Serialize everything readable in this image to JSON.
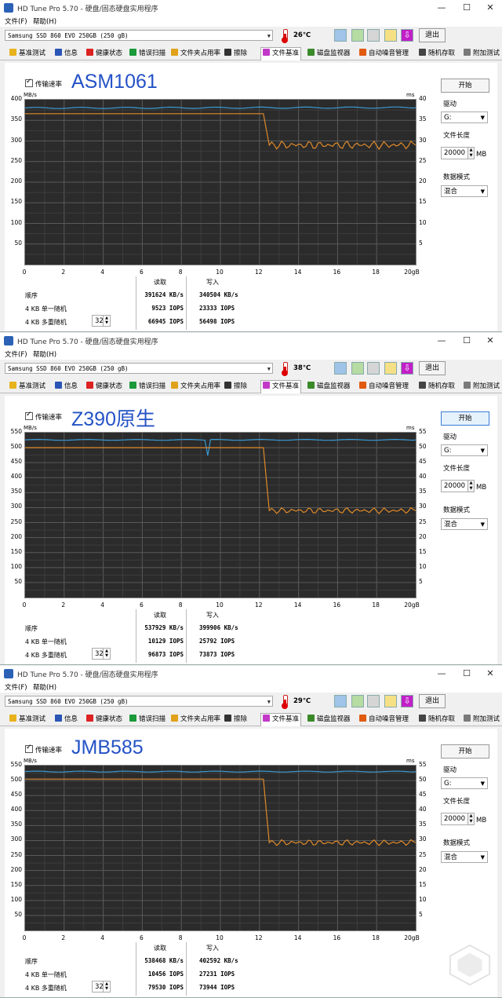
{
  "windows": [
    {
      "title": "HD Tune Pro 5.70 - 硬盘/固态硬盘实用程序",
      "menu": [
        "文件(F)",
        "帮助(H)"
      ],
      "drive": "Samsung SSD 860 EVO 250GB (250 gB)",
      "temperature": "26℃",
      "exit": "退出",
      "tabs": [
        "基准测试",
        "信息",
        "健康状态",
        "错误扫描",
        "文件夹占用率",
        "擦除",
        "文件基准",
        "磁盘监视器",
        "自动噪音管理",
        "随机存取",
        "附加测试"
      ],
      "active_tab": "文件基准",
      "checkbox_label": "传输速率",
      "label": "ASM1061",
      "start": "开始",
      "drive_label": "驱动",
      "drive_letter": "G:",
      "file_length_label": "文件长度",
      "file_length": "20000",
      "file_length_unit": "MB",
      "data_mode_label": "数据模式",
      "data_mode": "混合",
      "units_left": "MB/s",
      "units_right": "ms",
      "col_read": "读取",
      "col_write": "写入",
      "row_seq": "顺序",
      "row_4k": "4 KB 单一随机",
      "row_4k_multi": "4 KB 多重随机",
      "queue_depth": "32",
      "seq_read": "391624 KB/s",
      "seq_write": "340504 KB/s",
      "r4k_read": "9523 IOPS",
      "r4k_write": "23333 IOPS",
      "m4k_read": "66945 IOPS",
      "m4k_write": "56498 IOPS"
    },
    {
      "title": "HD Tune Pro 5.70 - 硬盘/固态硬盘实用程序",
      "menu": [
        "文件(F)",
        "帮助(H)"
      ],
      "drive": "Samsung SSD 860 EVO 250GB (250 gB)",
      "temperature": "38℃",
      "exit": "退出",
      "tabs": [
        "基准测试",
        "信息",
        "健康状态",
        "错误扫描",
        "文件夹占用率",
        "擦除",
        "文件基准",
        "磁盘监视器",
        "自动噪音管理",
        "随机存取",
        "附加测试"
      ],
      "active_tab": "文件基准",
      "checkbox_label": "传输速率",
      "label": "Z390原生",
      "start": "开始",
      "drive_label": "驱动",
      "drive_letter": "G:",
      "file_length_label": "文件长度",
      "file_length": "20000",
      "file_length_unit": "MB",
      "data_mode_label": "数据模式",
      "data_mode": "混合",
      "units_left": "MB/s",
      "units_right": "ms",
      "col_read": "读取",
      "col_write": "写入",
      "row_seq": "顺序",
      "row_4k": "4 KB 单一随机",
      "row_4k_multi": "4 KB 多重随机",
      "queue_depth": "32",
      "seq_read": "537929 KB/s",
      "seq_write": "399906 KB/s",
      "r4k_read": "10129 IOPS",
      "r4k_write": "25792 IOPS",
      "m4k_read": "96873 IOPS",
      "m4k_write": "73873 IOPS"
    },
    {
      "title": "HD Tune Pro 5.70 - 硬盘/固态硬盘实用程序",
      "menu": [
        "文件(F)",
        "帮助(H)"
      ],
      "drive": "Samsung SSD 860 EVO 250GB (250 gB)",
      "temperature": "29℃",
      "exit": "退出",
      "tabs": [
        "基准测试",
        "信息",
        "健康状态",
        "错误扫描",
        "文件夹占用率",
        "擦除",
        "文件基准",
        "磁盘监视器",
        "自动噪音管理",
        "随机存取",
        "附加测试"
      ],
      "active_tab": "文件基准",
      "checkbox_label": "传输速率",
      "label": "JMB585",
      "start": "开始",
      "drive_label": "驱动",
      "drive_letter": "G:",
      "file_length_label": "文件长度",
      "file_length": "20000",
      "file_length_unit": "MB",
      "data_mode_label": "数据模式",
      "data_mode": "混合",
      "units_left": "MB/s",
      "units_right": "ms",
      "col_read": "读取",
      "col_write": "写入",
      "row_seq": "顺序",
      "row_4k": "4 KB 单一随机",
      "row_4k_multi": "4 KB 多重随机",
      "queue_depth": "32",
      "seq_read": "538468 KB/s",
      "seq_write": "402592 KB/s",
      "r4k_read": "10456 IOPS",
      "r4k_write": "27231 IOPS",
      "m4k_read": "79530 IOPS",
      "m4k_write": "73944 IOPS"
    }
  ],
  "chart_data": [
    {
      "type": "line",
      "x_ticks": [
        "0",
        "2",
        "4",
        "6",
        "8",
        "10",
        "12",
        "14",
        "16",
        "18",
        "20gB"
      ],
      "y_ticks_left": [
        "400",
        "350",
        "300",
        "250",
        "200",
        "150",
        "100",
        "50"
      ],
      "y_ticks_right": [
        "40",
        "35",
        "30",
        "25",
        "20",
        "15",
        "10",
        "5"
      ],
      "ylim_left": [
        0,
        400
      ],
      "ylim_right": [
        0,
        40
      ],
      "xlim": [
        0,
        20
      ],
      "series": [
        {
          "color": "#3a9bd5",
          "x": [
            0,
            20
          ],
          "y": [
            380,
            381
          ]
        },
        {
          "color": "#e08a2a",
          "x": [
            0,
            12.2,
            12.5,
            20
          ],
          "y": [
            366,
            366,
            290,
            290
          ]
        }
      ],
      "grid": true
    },
    {
      "type": "line",
      "x_ticks": [
        "0",
        "2",
        "4",
        "6",
        "8",
        "10",
        "12",
        "14",
        "16",
        "18",
        "20gB"
      ],
      "y_ticks_left": [
        "550",
        "500",
        "450",
        "400",
        "350",
        "300",
        "250",
        "200",
        "150",
        "100",
        "50"
      ],
      "y_ticks_right": [
        "55",
        "50",
        "45",
        "40",
        "35",
        "30",
        "25",
        "20",
        "15",
        "10",
        "5"
      ],
      "ylim_left": [
        0,
        550
      ],
      "ylim_right": [
        0,
        55
      ],
      "xlim": [
        0,
        20
      ],
      "series": [
        {
          "color": "#3a9bd5",
          "x": [
            0,
            9.2,
            9.35,
            9.5,
            20
          ],
          "y": [
            526,
            526,
            475,
            526,
            526
          ]
        },
        {
          "color": "#e08a2a",
          "x": [
            0,
            12.2,
            12.5,
            20
          ],
          "y": [
            500,
            500,
            290,
            290
          ]
        }
      ],
      "grid": true
    },
    {
      "type": "line",
      "x_ticks": [
        "0",
        "2",
        "4",
        "6",
        "8",
        "10",
        "12",
        "14",
        "16",
        "18",
        "20gB"
      ],
      "y_ticks_left": [
        "550",
        "500",
        "450",
        "400",
        "350",
        "300",
        "250",
        "200",
        "150",
        "100",
        "50"
      ],
      "y_ticks_right": [
        "55",
        "50",
        "45",
        "40",
        "35",
        "30",
        "25",
        "20",
        "15",
        "10",
        "5"
      ],
      "ylim_left": [
        0,
        550
      ],
      "ylim_right": [
        0,
        55
      ],
      "xlim": [
        0,
        20
      ],
      "series": [
        {
          "color": "#3a9bd5",
          "x": [
            0,
            20
          ],
          "y": [
            530,
            530
          ]
        },
        {
          "color": "#e08a2a",
          "x": [
            0,
            12.2,
            12.5,
            20
          ],
          "y": [
            505,
            505,
            293,
            293
          ]
        }
      ],
      "grid": true
    }
  ]
}
